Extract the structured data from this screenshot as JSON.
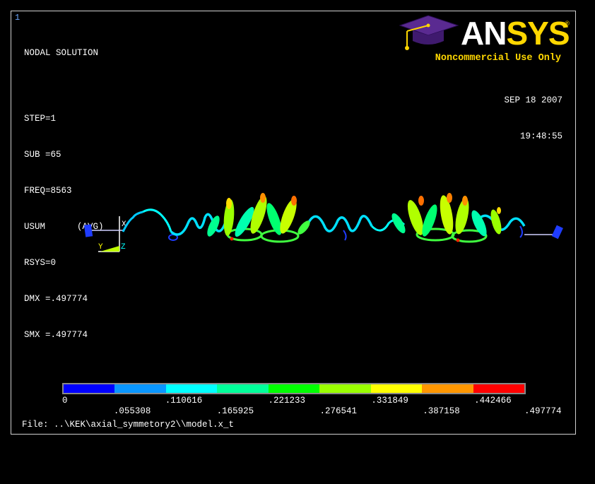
{
  "window": {
    "number": "1"
  },
  "info": {
    "title": "NODAL SOLUTION",
    "step": "STEP=1",
    "sub": "SUB =65",
    "freq": "FREQ=8563",
    "usum": "USUM      (AVG)",
    "rsys": "RSYS=0",
    "dmx": "DMX =.497774",
    "smx": "SMX =.497774"
  },
  "logo": {
    "brand_an": "AN",
    "brand_sys": "SYS",
    "reg": "®",
    "noncommercial": "Noncommercial Use Only"
  },
  "datetime": {
    "date": "SEP 18 2007",
    "time": "19:48:55"
  },
  "triad": {
    "y": "Y",
    "z": "Z",
    "x": "X"
  },
  "legend": {
    "colors": [
      "#0000ff",
      "#0a96ff",
      "#00ffff",
      "#00ff9a",
      "#00ff00",
      "#9aff00",
      "#ffff00",
      "#ff9600",
      "#ff0000"
    ],
    "labels_top": [
      "0",
      ".110616",
      ".221233",
      ".331849",
      ".442466"
    ],
    "labels_bottom": [
      ".055308",
      ".165925",
      ".276541",
      ".387158",
      ".497774"
    ]
  },
  "footer": {
    "file": "File: ..\\KEK\\axial_symmetory2\\\\model.x_t"
  }
}
